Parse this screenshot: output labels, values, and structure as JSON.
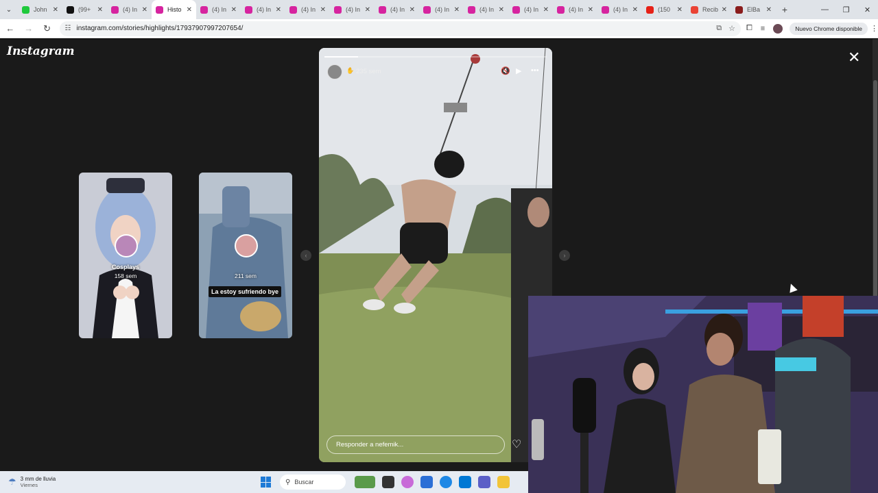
{
  "browser": {
    "tabs": [
      {
        "title": "John",
        "favicon_color": "#1fc93c"
      },
      {
        "title": "(99+",
        "favicon_color": "#111111"
      },
      {
        "title": "(4) In",
        "favicon_color": "#d6249f"
      },
      {
        "title": "Histo",
        "favicon_color": "#d6249f",
        "active": true
      },
      {
        "title": "(4) In",
        "favicon_color": "#d6249f"
      },
      {
        "title": "(4) In",
        "favicon_color": "#d6249f"
      },
      {
        "title": "(4) In",
        "favicon_color": "#d6249f"
      },
      {
        "title": "(4) In",
        "favicon_color": "#d6249f"
      },
      {
        "title": "(4) In",
        "favicon_color": "#d6249f"
      },
      {
        "title": "(4) In",
        "favicon_color": "#d6249f"
      },
      {
        "title": "(4) In",
        "favicon_color": "#d6249f"
      },
      {
        "title": "(4) In",
        "favicon_color": "#d6249f"
      },
      {
        "title": "(4) In",
        "favicon_color": "#d6249f"
      },
      {
        "title": "(4) In",
        "favicon_color": "#d6249f"
      },
      {
        "title": "(150",
        "favicon_color": "#e62117"
      },
      {
        "title": "Recib",
        "favicon_color": "#ea4335"
      },
      {
        "title": "ElBa",
        "favicon_color": "#8a1c1c"
      }
    ],
    "url": "instagram.com/stories/highlights/17937907997207654/",
    "update_label": "Nuevo Chrome disponible"
  },
  "instagram": {
    "logo": "Instagram",
    "previews": [
      {
        "title": "Cosplays",
        "time": "158 sem",
        "caption": ""
      },
      {
        "title": "",
        "time": "211 sem",
        "caption": "La estoy sufriendo bye"
      }
    ],
    "story": {
      "time": "235 sem",
      "progress": 0.15,
      "reply_placeholder": "Responder a nefemik..."
    }
  },
  "taskbar": {
    "weather_main": "3 mm de lluvia",
    "weather_sub": "Viernes",
    "search_label": "Buscar"
  }
}
